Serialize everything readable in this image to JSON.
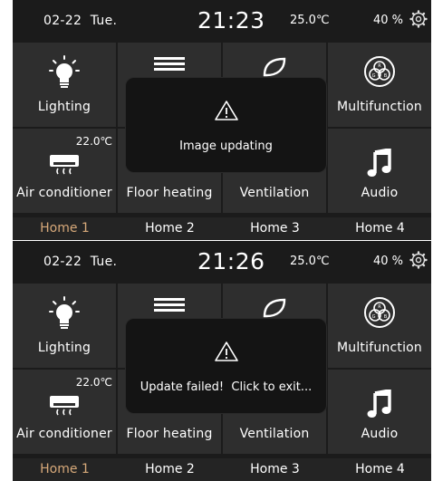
{
  "screens": [
    {
      "status": {
        "date": "02-22",
        "weekday": "Tue.",
        "time": "21:23",
        "temperature": "25.0℃",
        "humidity": "40 %"
      },
      "tiles": {
        "lighting": "Lighting",
        "multifunction": "Multifunction",
        "air_conditioner": "Air conditioner",
        "air_conditioner_temp": "22.0℃",
        "floor_heating": "Floor heating",
        "ventilation": "Ventilation",
        "audio": "Audio"
      },
      "homes": [
        "Home 1",
        "Home 2",
        "Home 3",
        "Home 4"
      ],
      "active_home": "Home 1",
      "dialog": {
        "message": "Image updating",
        "icon": "warning-icon"
      }
    },
    {
      "status": {
        "date": "02-22",
        "weekday": "Tue.",
        "time": "21:26",
        "temperature": "25.0℃",
        "humidity": "40 %"
      },
      "tiles": {
        "lighting": "Lighting",
        "multifunction": "Multifunction",
        "air_conditioner": "Air conditioner",
        "air_conditioner_temp": "22.0℃",
        "floor_heating": "Floor heating",
        "ventilation": "Ventilation",
        "audio": "Audio"
      },
      "homes": [
        "Home 1",
        "Home 2",
        "Home 3",
        "Home 4"
      ],
      "active_home": "Home 1",
      "dialog": {
        "message": "Update failed!  Click to exit...",
        "icon": "warning-icon"
      }
    }
  ],
  "colors": {
    "background": "#1b1b1b",
    "tile": "#2e2e2e",
    "dialog": "#141414",
    "active_home": "#d7a97a"
  }
}
